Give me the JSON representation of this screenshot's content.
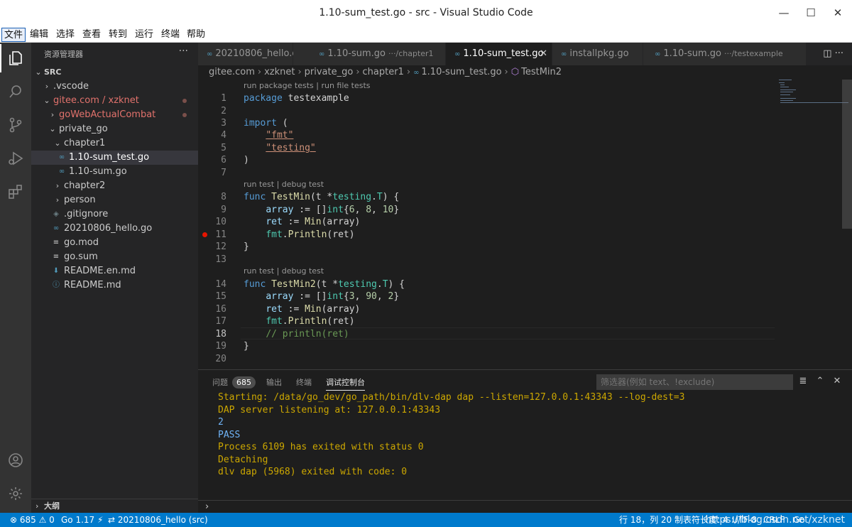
{
  "window": {
    "title": "1.10-sum_test.go - src - Visual Studio Code",
    "minimize": "—",
    "maximize": "☐",
    "close": "✕"
  },
  "menu": [
    "文件",
    "编辑",
    "选择",
    "查看",
    "转到",
    "运行",
    "终端",
    "帮助"
  ],
  "sidebar": {
    "title": "资源管理器",
    "more": "···",
    "root": "SRC",
    "items": [
      {
        "label": "SRC",
        "chev": "⌄",
        "icon": ""
      },
      {
        "label": ".vscode",
        "chev": "›",
        "icon": ""
      },
      {
        "label": "gitee.com / xzknet",
        "chev": "⌄",
        "icon": ""
      },
      {
        "label": "goWebActualCombat",
        "chev": "›",
        "icon": ""
      },
      {
        "label": "private_go",
        "chev": "⌄",
        "icon": ""
      },
      {
        "label": "chapter1",
        "chev": "⌄",
        "icon": ""
      },
      {
        "label": "1.10-sum_test.go",
        "chev": "",
        "icon": "∞"
      },
      {
        "label": "1.10-sum.go",
        "chev": "",
        "icon": "∞"
      },
      {
        "label": "chapter2",
        "chev": "›",
        "icon": ""
      },
      {
        "label": "person",
        "chev": "›",
        "icon": ""
      },
      {
        "label": ".gitignore",
        "chev": "",
        "icon": "◈"
      },
      {
        "label": "20210806_hello.go",
        "chev": "",
        "icon": "∞"
      },
      {
        "label": "go.mod",
        "chev": "",
        "icon": "≡"
      },
      {
        "label": "go.sum",
        "chev": "",
        "icon": "≡"
      },
      {
        "label": "README.en.md",
        "chev": "",
        "icon": "⬇"
      },
      {
        "label": "README.md",
        "chev": "",
        "icon": "ⓘ"
      }
    ],
    "outline": "大纲",
    "outline_chev": "›"
  },
  "tabs": [
    {
      "label": "20210806_hello.go",
      "desc": ""
    },
    {
      "label": "1.10-sum.go",
      "desc": "···/chapter1"
    },
    {
      "label": "1.10-sum_test.go",
      "desc": ""
    },
    {
      "label": "installpkg.go",
      "desc": ""
    },
    {
      "label": "1.10-sum.go",
      "desc": "···/testexample"
    }
  ],
  "tab_icon": "∞",
  "tab_close": "✕",
  "tab_actions": "◫  ···",
  "breadcrumb": [
    "gitee.com",
    "xzknet",
    "private_go",
    "chapter1",
    "1.10-sum_test.go",
    "TestMin2"
  ],
  "breadcrumb_sep": "›",
  "codelens": {
    "file": "run package tests | run file tests",
    "test1": "run test | debug test",
    "test2": "run test | debug test"
  },
  "line_numbers": [
    "1",
    "2",
    "3",
    "4",
    "5",
    "6",
    "7",
    "8",
    "9",
    "10",
    "11",
    "12",
    "13",
    "14",
    "15",
    "16",
    "17",
    "18",
    "19",
    "20"
  ],
  "code": {
    "l1a": "package",
    "l1b": " testexample",
    "l3a": "import",
    "l3b": " (",
    "l4a": "    ",
    "l4b": "\"fmt\"",
    "l5a": "    ",
    "l5b": "\"testing\"",
    "l6": ")",
    "l8a": "func",
    "l8b": " ",
    "l8c": "TestMin",
    "l8d": "(t *",
    "l8e": "testing",
    "l8f": ".",
    "l8g": "T",
    "l8h": ") {",
    "l9a": "    ",
    "l9b": "array",
    "l9c": " := []",
    "l9d": "int",
    "l9e": "{",
    "l9f": "6",
    "l9g": ", ",
    "l9h": "8",
    "l9i": ", ",
    "l9j": "10",
    "l9k": "}",
    "l10a": "    ",
    "l10b": "ret",
    "l10c": " := ",
    "l10d": "Min",
    "l10e": "(array)",
    "l11a": "    ",
    "l11b": "fmt",
    "l11c": ".",
    "l11d": "Println",
    "l11e": "(ret)",
    "l12": "}",
    "l14a": "func",
    "l14b": " ",
    "l14c": "TestMin2",
    "l14d": "(t *",
    "l14e": "testing",
    "l14f": ".",
    "l14g": "T",
    "l14h": ") {",
    "l15a": "    ",
    "l15b": "array",
    "l15c": " := []",
    "l15d": "int",
    "l15e": "{",
    "l15f": "3",
    "l15g": ", ",
    "l15h": "90",
    "l15i": ", ",
    "l15j": "2",
    "l15k": "}",
    "l16a": "    ",
    "l16b": "ret",
    "l16c": " := ",
    "l16d": "Min",
    "l16e": "(array)",
    "l17a": "    ",
    "l17b": "fmt",
    "l17c": ".",
    "l17d": "Println",
    "l17e": "(ret)",
    "l18a": "    ",
    "l18b": "// println(ret)",
    "l19": "}"
  },
  "panel": {
    "tabs": [
      "问题",
      "输出",
      "终端",
      "调试控制台"
    ],
    "problems_count": "685",
    "filter_placeholder": "筛选器(例如 text、!exclude)",
    "actions": [
      "≣",
      "⌃",
      "✕"
    ],
    "output": [
      "Starting: /data/go_dev/go_path/bin/dlv-dap dap --listen=127.0.0.1:43343 --log-dest=3",
      "DAP server listening at: 127.0.0.1:43343",
      "2",
      "PASS",
      "Process 6109 has exited with status 0",
      "Detaching",
      "dlv dap (5968) exited with code: 0"
    ],
    "repl_prompt": "›"
  },
  "statusbar": {
    "problems": "⊗ 685 ⚠ 0",
    "go_version": "Go 1.17 ⚡",
    "debug": "⇄ 20210806_hello (src)",
    "position": "行 18，列 20",
    "tab_size": "制表符长度: 4",
    "encoding": "UTF-8",
    "eol": "CRLF",
    "lang": "Go",
    "watermark": "https://blog.csdn.net/xzknet"
  },
  "colors": {
    "accent": "#007acc",
    "editor_bg": "#1e1e1e",
    "sidebar_bg": "#252526",
    "activity_bg": "#333333",
    "git_modified": "#e2726c",
    "output_yellow": "#cca700",
    "output_blue": "#6fb3f6"
  },
  "icons": {
    "activity": [
      "explorer-icon",
      "search-icon",
      "source-control-icon",
      "run-debug-icon",
      "extensions-icon",
      "account-icon",
      "settings-gear-icon"
    ]
  }
}
